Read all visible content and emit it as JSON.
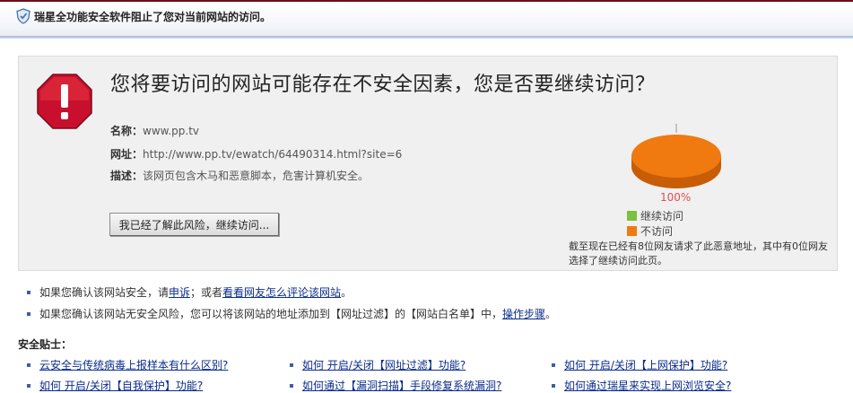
{
  "topbar": {
    "title": "瑞星全功能安全软件阻止了您对当前网站的访问。"
  },
  "warning": {
    "headline": "您将要访问的网站可能存在不安全因素，您是否要继续访问？",
    "name_label": "名称：",
    "name_value": "www.pp.tv",
    "url_label": "网址：",
    "url_value": "http://www.pp.tv/ewatch/64490314.html?site=6",
    "desc_label": "描述：",
    "desc_value": "该网页包含木马和恶意脚本，危害计算机安全。",
    "continue_button": "我已经了解此风险，继续访问..."
  },
  "chart_data": {
    "type": "pie",
    "categories": [
      "继续访问",
      "不访问"
    ],
    "values": [
      0,
      100
    ],
    "colors": [
      "#7ac142",
      "#f07a10"
    ],
    "data_label": "100%",
    "legend_position": "bottom"
  },
  "stats": {
    "text": "截至现在已经有8位网友请求了此恶意地址，其中有0位网友选择了继续访问此页。"
  },
  "bullets": [
    {
      "pre": "如果您确认该网站安全，请",
      "link1": "申诉",
      "mid": "；或者",
      "link2": "看看网友怎么评论该网站",
      "post": "。"
    },
    {
      "pre": "如果您确认该网站无安全风险，您可以将该网站的地址添加到【网址过滤】的【网站白名单】中，",
      "link1": "操作步骤",
      "post": "。"
    }
  ],
  "tips": {
    "title": "安全贴士：",
    "links": [
      "云安全与传统病毒上报样本有什么区别?",
      "如何 开启/关闭【网址过滤】功能?",
      "如何 开启/关闭【上网保护】功能?",
      "如何 开启/关闭【自我保护】功能?",
      "如何通过【漏洞扫描】手段修复系统漏洞?",
      "如何通过瑞星来实现上网浏览安全?"
    ]
  }
}
